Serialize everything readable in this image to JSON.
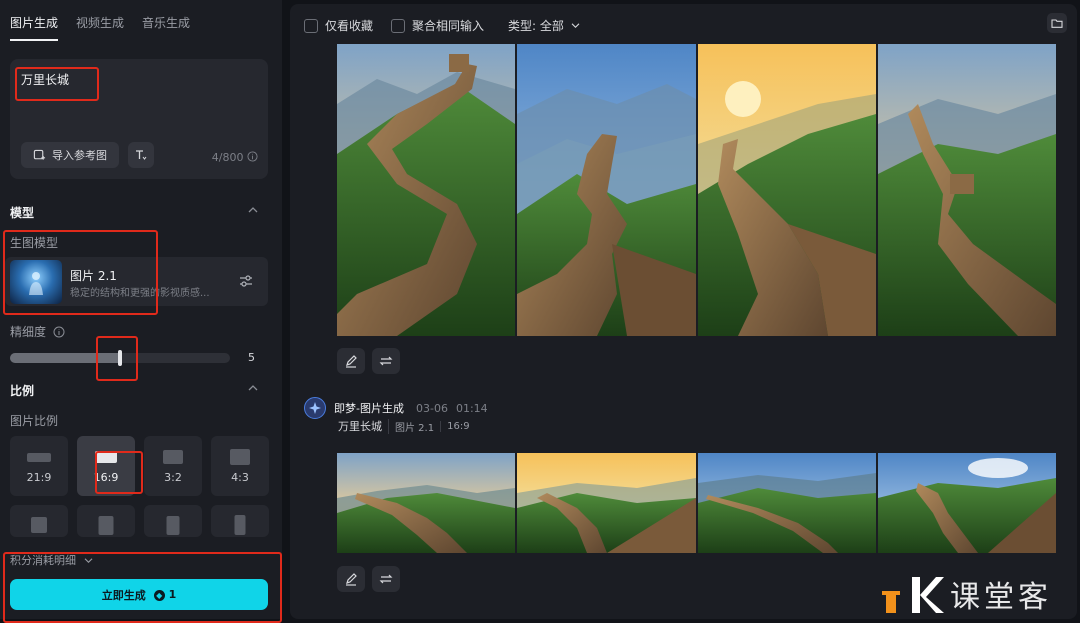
{
  "left": {
    "tabs": [
      "图片生成",
      "视频生成",
      "音乐生成"
    ],
    "prompt": {
      "text": "万里长城",
      "ref_button": "导入参考图",
      "counter": "4/800"
    },
    "model_section": {
      "title": "模型",
      "sub_label": "生图模型",
      "name": "图片 2.1",
      "description": "稳定的结构和更强的影视质感..."
    },
    "detail": {
      "label": "精细度",
      "value": "5",
      "level_fraction": 0.5
    },
    "ratio_section": {
      "title": "比例",
      "sub_label": "图片比例",
      "options": [
        "21:9",
        "16:9",
        "3:2",
        "4:3"
      ],
      "selected": "16:9"
    },
    "credits_label": "积分消耗明细",
    "generate": {
      "label": "立即生成",
      "cost": "1"
    }
  },
  "right": {
    "filters": {
      "favorites": "仅看收藏",
      "merge": "聚合相同输入",
      "type": "类型: 全部"
    },
    "generation": {
      "title": "即梦-图片生成",
      "date": "03-06",
      "time": "01:14",
      "prompt": "万里长城",
      "model_tag": "图片 2.1",
      "ratio_tag": "16:9"
    }
  },
  "colors": {
    "accent": "#10d4e8",
    "highlight": "#e02a1b",
    "background": "#111318",
    "panel": "#1b1d23"
  },
  "icons": [
    "image-import-icon",
    "text-style-icon",
    "info-icon",
    "settings-sliders-icon",
    "chevron-up-icon",
    "chevron-down-icon",
    "folder-icon",
    "edit-icon",
    "regenerate-icon",
    "coin-icon"
  ]
}
